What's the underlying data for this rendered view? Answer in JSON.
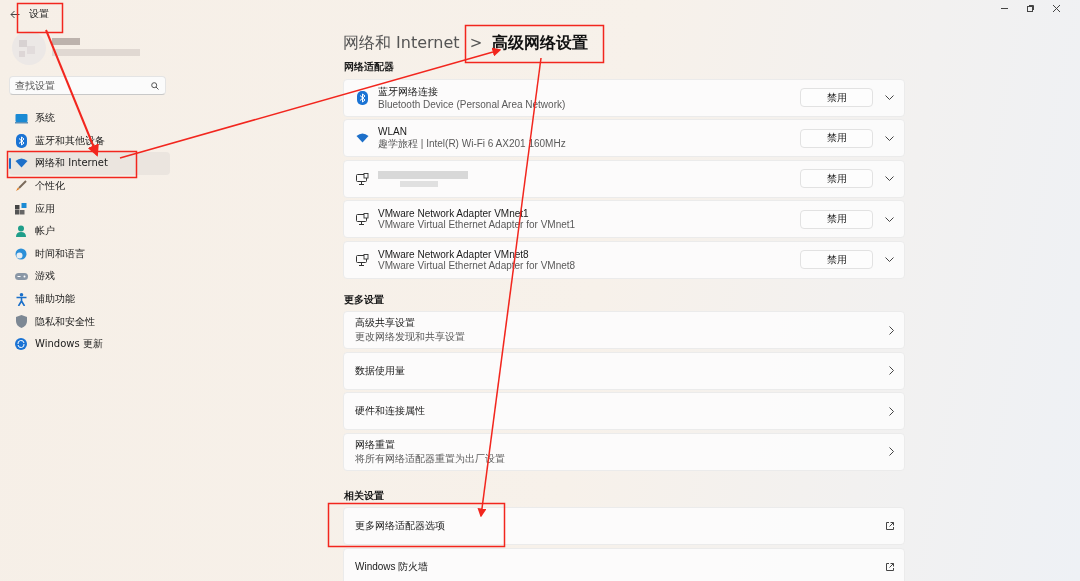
{
  "window": {
    "title": "设置"
  },
  "search": {
    "placeholder": "查找设置"
  },
  "nav": [
    {
      "label": "系统",
      "selected": false
    },
    {
      "label": "蓝牙和其他设备",
      "selected": false
    },
    {
      "label": "网络和 Internet",
      "selected": true
    },
    {
      "label": "个性化",
      "selected": false
    },
    {
      "label": "应用",
      "selected": false
    },
    {
      "label": "帐户",
      "selected": false
    },
    {
      "label": "时间和语言",
      "selected": false
    },
    {
      "label": "游戏",
      "selected": false
    },
    {
      "label": "辅助功能",
      "selected": false
    },
    {
      "label": "隐私和安全性",
      "selected": false
    },
    {
      "label": "Windows 更新",
      "selected": false
    }
  ],
  "breadcrumb": {
    "parent": "网络和 Internet",
    "separator": ">",
    "current": "高级网络设置"
  },
  "sections": [
    {
      "title": "网络适配器",
      "items": [
        {
          "kind": "bluetooth",
          "redacted": false,
          "name": "蓝牙网络连接",
          "description": "Bluetooth Device (Personal Area Network)",
          "button": "禁用"
        },
        {
          "kind": "wifi",
          "redacted": false,
          "name": "WLAN",
          "description": "趣学旅程 | Intel(R) Wi-Fi 6 AX201 160MHz",
          "button": "禁用"
        },
        {
          "kind": "wired",
          "redacted": true,
          "button": "禁用"
        },
        {
          "kind": "wired",
          "redacted": false,
          "name": "VMware Network Adapter VMnet1",
          "description": "VMware Virtual Ethernet Adapter for VMnet1",
          "button": "禁用"
        },
        {
          "kind": "wired",
          "redacted": false,
          "name": "VMware Network Adapter VMnet8",
          "description": "VMware Virtual Ethernet Adapter for VMnet8",
          "button": "禁用"
        }
      ]
    },
    {
      "title": "更多设置",
      "items": [
        {
          "kind": "link",
          "name": "高级共享设置",
          "description": "更改网络发现和共享设置"
        },
        {
          "kind": "link",
          "name": "数据使用量"
        },
        {
          "kind": "link",
          "name": "硬件和连接属性"
        },
        {
          "kind": "link",
          "name": "网络重置",
          "description": "将所有网络适配器重置为出厂设置"
        }
      ]
    },
    {
      "title": "相关设置",
      "items": [
        {
          "kind": "external",
          "name": "更多网络适配器选项"
        },
        {
          "kind": "external",
          "name": "Windows 防火墙"
        }
      ]
    }
  ]
}
